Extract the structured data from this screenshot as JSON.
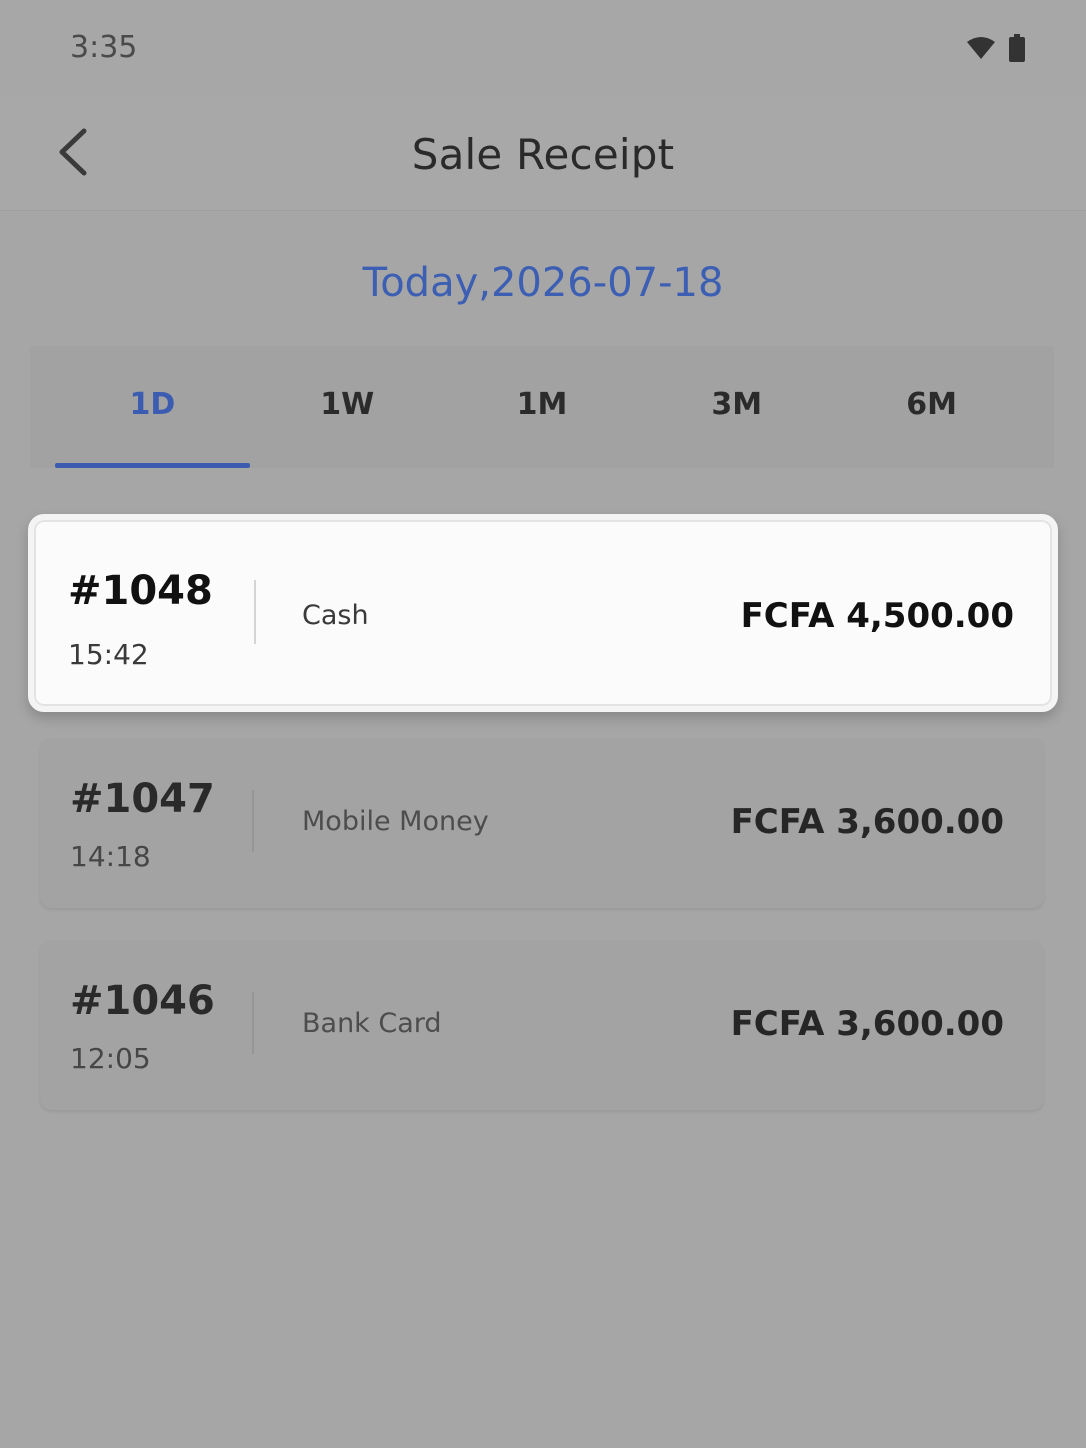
{
  "status_bar": {
    "time": "3:35",
    "icons": [
      "wifi-icon",
      "battery-icon"
    ]
  },
  "header": {
    "back_icon": "chevron-left-icon",
    "title": "Sale Receipt"
  },
  "date_label": "Today,2026-07-18",
  "tabs": [
    {
      "label": "1D",
      "active": true
    },
    {
      "label": "1W",
      "active": false
    },
    {
      "label": "1M",
      "active": false
    },
    {
      "label": "3M",
      "active": false
    },
    {
      "label": "6M",
      "active": false
    }
  ],
  "receipts": [
    {
      "number": "#1048",
      "time": "15:42",
      "method": "Cash",
      "amount": "FCFA 4,500.00",
      "highlighted": true
    },
    {
      "number": "#1047",
      "time": "14:18",
      "method": "Mobile Money",
      "amount": "FCFA 3,600.00",
      "highlighted": false
    },
    {
      "number": "#1046",
      "time": "12:05",
      "method": "Bank Card",
      "amount": "FCFA 3,600.00",
      "highlighted": false
    }
  ],
  "colors": {
    "accent": "#3b5cb0",
    "background": "#a6a6a6",
    "card_highlight": "#fbfbfb"
  }
}
